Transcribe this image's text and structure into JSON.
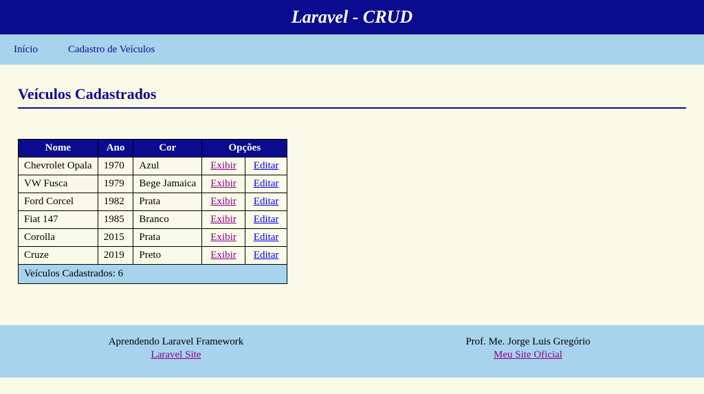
{
  "header": {
    "title": "Laravel - CRUD"
  },
  "nav": {
    "home": "Início",
    "register": "Cadastro de Veículos"
  },
  "page": {
    "title": "Veículos Cadastrados"
  },
  "table": {
    "headers": {
      "name": "Nome",
      "year": "Ano",
      "color": "Cor",
      "options": "Opções"
    },
    "rows": [
      {
        "name": "Chevrolet Opala",
        "year": "1970",
        "color": "Azul"
      },
      {
        "name": "VW Fusca",
        "year": "1979",
        "color": "Bege Jamaica"
      },
      {
        "name": "Ford Corcel",
        "year": "1982",
        "color": "Prata"
      },
      {
        "name": "Fiat 147",
        "year": "1985",
        "color": "Branco"
      },
      {
        "name": "Corolla",
        "year": "2015",
        "color": "Prata"
      },
      {
        "name": "Cruze",
        "year": "2019",
        "color": "Preto"
      }
    ],
    "action_view": "Exibir",
    "action_edit": "Editar",
    "footer_text": "Veículos Cadastrados: 6"
  },
  "footer": {
    "left_text": "Aprendendo Laravel Framework",
    "left_link": "Laravel Site",
    "right_text": "Prof. Me. Jorge Luis Gregório",
    "right_link": "Meu Site Oficial"
  }
}
